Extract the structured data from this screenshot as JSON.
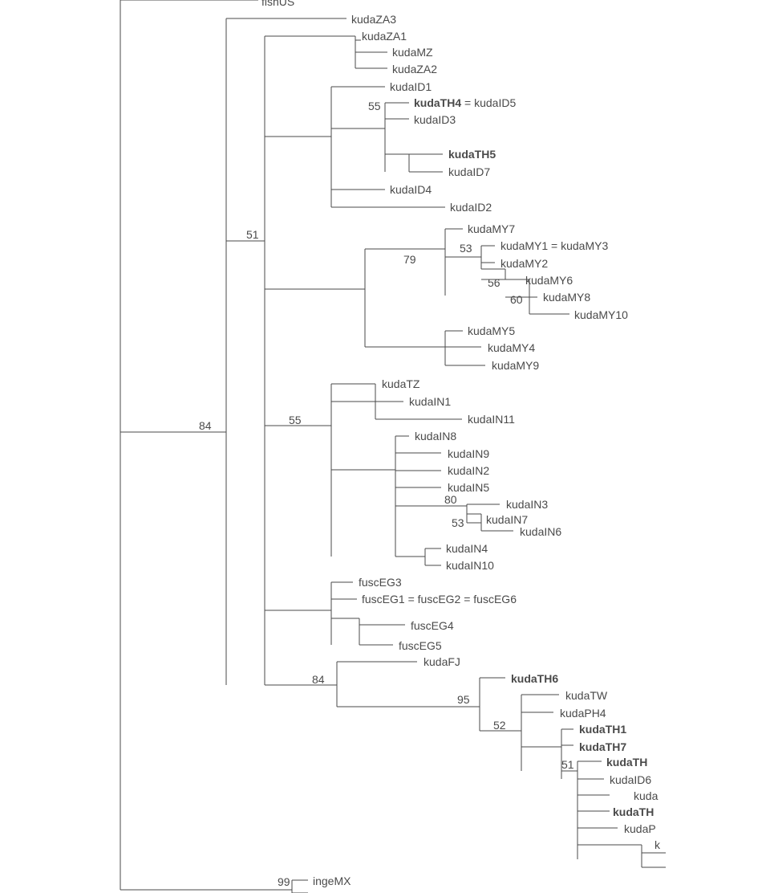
{
  "taxa": {
    "fishUS": "fishUS",
    "kudaZA3": "kudaZA3",
    "kudaZA1": "kudaZA1",
    "kudaMZ": "kudaMZ",
    "kudaZA2": "kudaZA2",
    "kudaID1": "kudaID1",
    "kudaTH4": "kudaTH4",
    "kudaTH4suffix": " = kudaID5",
    "kudaID3": "kudaID3",
    "kudaTH5": "kudaTH5",
    "kudaID7": "kudaID7",
    "kudaID4": "kudaID4",
    "kudaID2": "kudaID2",
    "kudaMY7": "kudaMY7",
    "kudaMY1": "kudaMY1 = kudaMY3",
    "kudaMY2": "kudaMY2",
    "kudaMY6": "kudaMY6",
    "kudaMY8": "kudaMY8",
    "kudaMY10": "kudaMY10",
    "kudaMY5": "kudaMY5",
    "kudaMY4": "kudaMY4",
    "kudaMY9": "kudaMY9",
    "kudaTZ": "kudaTZ",
    "kudaIN1": "kudaIN1",
    "kudaIN11": "kudaIN11",
    "kudaIN8": "kudaIN8",
    "kudaIN9": "kudaIN9",
    "kudaIN2": "kudaIN2",
    "kudaIN5": "kudaIN5",
    "kudaIN3": "kudaIN3",
    "kudaIN7": "kudaIN7",
    "kudaIN6": "kudaIN6",
    "kudaIN4": "kudaIN4",
    "kudaIN10": "kudaIN10",
    "fuscEG3": "fuscEG3",
    "fuscEG1": "fuscEG1 = fuscEG2 = fuscEG6",
    "fuscEG4": "fuscEG4",
    "fuscEG5": "fuscEG5",
    "kudaFJ": "kudaFJ",
    "kudaTH6": "kudaTH6",
    "kudaTW": "kudaTW",
    "kudaPH4": "kudaPH4",
    "kudaTH1": "kudaTH1",
    "kudaTH7": "kudaTH7",
    "kudaTHx": "kudaTH",
    "kudaID6": "kudaID6",
    "kudax": "kuda",
    "kudaTHy": "kudaTH",
    "kudaPx": "kudaP",
    "kx": "k",
    "ingeMX": "ingeMX"
  },
  "supports": {
    "s84": "84",
    "s51": "51",
    "s55a": "55",
    "s79": "79",
    "s53a": "53",
    "s56": "56",
    "s60": "60",
    "s55b": "55",
    "s80": "80",
    "s53b": "53",
    "s84b": "84",
    "s95": "95",
    "s52": "52",
    "s51b": "51",
    "s99": "99"
  }
}
